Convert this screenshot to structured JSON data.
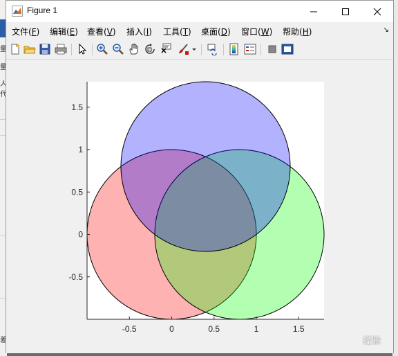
{
  "window": {
    "title": "Figure 1"
  },
  "menu": [
    {
      "label": "文件(F)",
      "text": "文件(",
      "key": "F",
      "tail": ")"
    },
    {
      "label": "编辑(E)",
      "text": "编辑(",
      "key": "E",
      "tail": ")"
    },
    {
      "label": "查看(V)",
      "text": "查看(",
      "key": "V",
      "tail": ")"
    },
    {
      "label": "插入(I)",
      "text": "插入(",
      "key": "I",
      "tail": ")"
    },
    {
      "label": "工具(T)",
      "text": "工具(",
      "key": "T",
      "tail": ")"
    },
    {
      "label": "桌面(D)",
      "text": "桌面(",
      "key": "D",
      "tail": ")"
    },
    {
      "label": "窗口(W)",
      "text": "窗口(",
      "key": "W",
      "tail": ")"
    },
    {
      "label": "帮助(H)",
      "text": "帮助(",
      "key": "H",
      "tail": ")"
    }
  ],
  "menu_overflow": "↘",
  "toolbar_icons": [
    "new-figure-icon",
    "open-file-icon",
    "save-icon",
    "print-icon",
    "pointer-icon",
    "zoom-in-icon",
    "zoom-out-icon",
    "pan-hand-icon",
    "rotate-3d-icon",
    "data-cursor-icon",
    "brush-icon",
    "link-plot-icon",
    "colorbar-icon",
    "legend-icon",
    "hide-plot-tools-icon",
    "show-plot-tools-icon"
  ],
  "left_edge_text": [
    "量",
    "量",
    "人代",
    "差"
  ],
  "watermark": "经验",
  "colors": {
    "red": "#ff0000",
    "green": "#00ff00",
    "blue": "#0000ff",
    "alpha": 0.3
  },
  "chart_data": {
    "type": "venn",
    "title": "",
    "xlabel": "",
    "ylabel": "",
    "xlim": [
      -1,
      1.8
    ],
    "ylim": [
      -1,
      1.8
    ],
    "xticks": [
      -0.5,
      0,
      0.5,
      1,
      1.5
    ],
    "xtick_labels": [
      "-0.5",
      "0",
      "0.5",
      "1",
      "1.5"
    ],
    "yticks": [
      -0.5,
      0,
      0.5,
      1,
      1.5
    ],
    "ytick_labels": [
      "-0.5",
      "0",
      "0.5",
      "1",
      "1.5"
    ],
    "circles": [
      {
        "color": "red",
        "cx": 0,
        "cy": 0,
        "r": 1
      },
      {
        "color": "green",
        "cx": 0.8,
        "cy": 0,
        "r": 1
      },
      {
        "color": "blue",
        "cx": 0.4,
        "cy": 0.8,
        "r": 1
      }
    ]
  }
}
